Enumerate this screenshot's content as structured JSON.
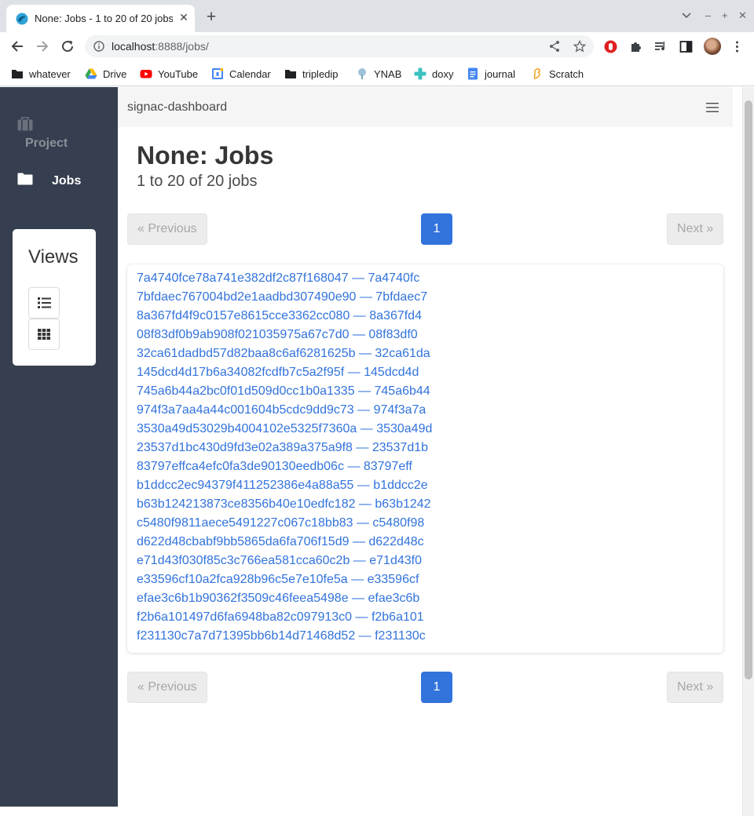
{
  "browser": {
    "tab_title": "None: Jobs - 1 to 20 of 20 jobs",
    "url_host": "localhost",
    "url_rest": ":8888/jobs/",
    "bookmarks": [
      "whatever",
      "Drive",
      "YouTube",
      "Calendar",
      "tripledip",
      "YNAB",
      "doxy",
      "journal",
      "Scratch"
    ]
  },
  "sidebar": {
    "project_label": "Project",
    "jobs_label": "Jobs",
    "views_title": "Views"
  },
  "navbar": {
    "brand": "signac-dashboard"
  },
  "main": {
    "title": "None: Jobs",
    "subtitle": "1 to 20 of 20 jobs"
  },
  "pagination": {
    "previous_label": "« Previous",
    "next_label": "Next »",
    "current_page": "1"
  },
  "jobs": [
    "7a4740fce78a741e382df2c87f168047 — 7a4740fc",
    "7bfdaec767004bd2e1aadbd307490e90 — 7bfdaec7",
    "8a367fd4f9c0157e8615cce3362cc080 — 8a367fd4",
    "08f83df0b9ab908f021035975a67c7d0 — 08f83df0",
    "32ca61dadbd57d82baa8c6af6281625b — 32ca61da",
    "145dcd4d17b6a34082fcdfb7c5a2f95f — 145dcd4d",
    "745a6b44a2bc0f01d509d0cc1b0a1335 — 745a6b44",
    "974f3a7aa4a44c001604b5cdc9dd9c73 — 974f3a7a",
    "3530a49d53029b4004102e5325f7360a — 3530a49d",
    "23537d1bc430d9fd3e02a389a375a9f8 — 23537d1b",
    "83797effca4efc0fa3de90130eedb06c — 83797eff",
    "b1ddcc2ec94379f411252386e4a88a55 — b1ddcc2e",
    "b63b124213873ce8356b40e10edfc182 — b63b1242",
    "c5480f9811aece5491227c067c18bb83 — c5480f98",
    "d622d48cbabf9bb5865da6fa706f15d9 — d622d48c",
    "e71d43f030f85c3c766ea581cca60c2b — e71d43f0",
    "e33596cf10a2fca928b96c5e7e10fe5a — e33596cf",
    "efae3c6b1b90362f3509c46feea5498e — efae3c6b",
    "f2b6a101497d6fa6948ba82c097913c0 — f2b6a101",
    "f231130c7a7d71395bb6b14d71468d52 — f231130c"
  ],
  "colors": {
    "sidebar_bg": "#363f4f",
    "link": "#3273dc",
    "current_page": "#3273dc",
    "navbar_bg": "#f5f5f5"
  },
  "icons": {
    "project": "briefcase-icon",
    "jobs": "folder-icon",
    "list_view": "list-icon",
    "grid_view": "grid-icon",
    "menu": "hamburger-icon"
  }
}
